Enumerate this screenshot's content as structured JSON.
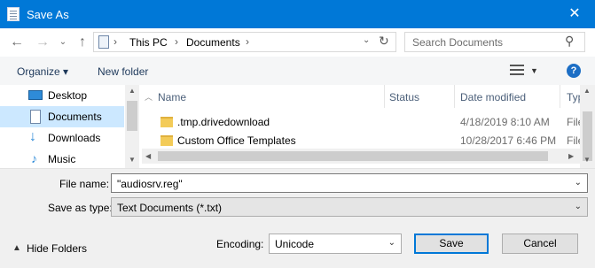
{
  "window": {
    "title": "Save As",
    "close_glyph": "✕"
  },
  "address": {
    "crumbs": [
      "This PC",
      "Documents"
    ],
    "separator": "›",
    "dropdown_glyph": "⌄",
    "refresh_glyph": "↻"
  },
  "nav_buttons": {
    "back": "←",
    "forward": "→",
    "recent": "⌄",
    "up": "↑"
  },
  "search": {
    "placeholder": "Search Documents",
    "icon_glyph": "⚲"
  },
  "toolbar": {
    "organize": "Organize ▾",
    "new_folder": "New folder",
    "help": "?"
  },
  "nav_pane": {
    "items": [
      {
        "label": "Desktop",
        "icon": "desktop-icon"
      },
      {
        "label": "Documents",
        "icon": "documents-icon",
        "selected": true
      },
      {
        "label": "Downloads",
        "icon": "downloads-icon"
      },
      {
        "label": "Music",
        "icon": "music-icon"
      }
    ]
  },
  "file_list": {
    "columns": [
      "Name",
      "Status",
      "Date modified",
      "Typ"
    ],
    "rows": [
      {
        "name": ".tmp.drivedownload",
        "status": "",
        "date": "4/18/2019 8:10 AM",
        "type": "File"
      },
      {
        "name": "Custom Office Templates",
        "status": "",
        "date": "10/28/2017 6:46 PM",
        "type": "File"
      }
    ]
  },
  "form": {
    "file_name_label": "File name:",
    "file_name_value": "\"audiosrv.reg\"",
    "save_as_type_label": "Save as type:",
    "save_as_type_value": "Text Documents (*.txt)",
    "encoding_label": "Encoding:",
    "encoding_value": "Unicode"
  },
  "footer": {
    "hide_folders": "Hide Folders",
    "save": "Save",
    "cancel": "Cancel"
  },
  "colors": {
    "titlebar": "#0078d7",
    "selection": "#cce8ff",
    "help": "#1c6ec5"
  }
}
